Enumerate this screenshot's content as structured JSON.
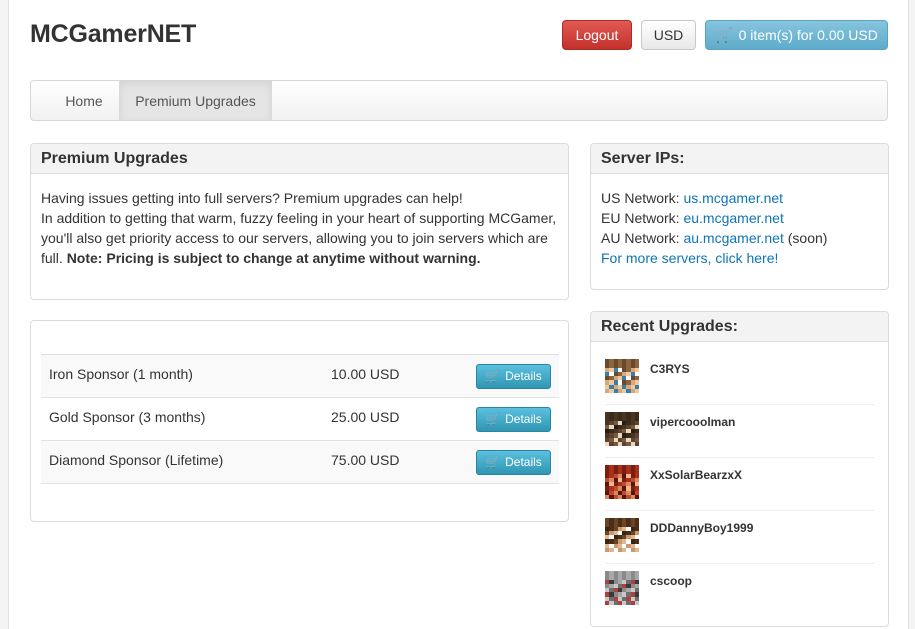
{
  "brand": "MCGamerNET",
  "header": {
    "logout_label": "Logout",
    "currency_label": "USD",
    "cart_label": "0 item(s) for 0.00 USD"
  },
  "nav": {
    "home": "Home",
    "active": "Premium Upgrades"
  },
  "upgrades_panel": {
    "title": "Premium Upgrades",
    "line1": "Having issues getting into full servers? Premium upgrades can help!",
    "line2": "In addition to getting that warm, fuzzy feeling in your heart of supporting MCGamer, you'll also get priority access to our servers, allowing you to join servers which are full. ",
    "note": "Note: Pricing is subject to change at anytime without warning."
  },
  "products": [
    {
      "name": "Iron Sponsor (1 month)",
      "price": "10.00 USD",
      "button": "Details"
    },
    {
      "name": "Gold Sponsor (3 months)",
      "price": "25.00 USD",
      "button": "Details"
    },
    {
      "name": "Diamond Sponsor (Lifetime)",
      "price": "75.00 USD",
      "button": "Details"
    }
  ],
  "servers_panel": {
    "title": "Server IPs:",
    "us_label": "US Network: ",
    "us_link": "us.mcgamer.net",
    "eu_label": "EU Network: ",
    "eu_link": "eu.mcgamer.net",
    "au_label": "AU Network: ",
    "au_link": "au.mcgamer.net",
    "au_suffix": " (soon)",
    "more_link": "For more servers, click here!"
  },
  "recent_panel": {
    "title": "Recent Upgrades:",
    "users": [
      {
        "name": "C3RYS"
      },
      {
        "name": "vipercooolman"
      },
      {
        "name": "XxSolarBearzxX"
      },
      {
        "name": "DDDannyBoy1999"
      },
      {
        "name": "cscoop"
      }
    ]
  },
  "colors": {
    "logout": "#d9443f",
    "cart": "#74b8d6",
    "details": "#3fa9cd",
    "link": "#0e74b6"
  },
  "icons": {
    "cart": "shopping-cart-icon"
  }
}
